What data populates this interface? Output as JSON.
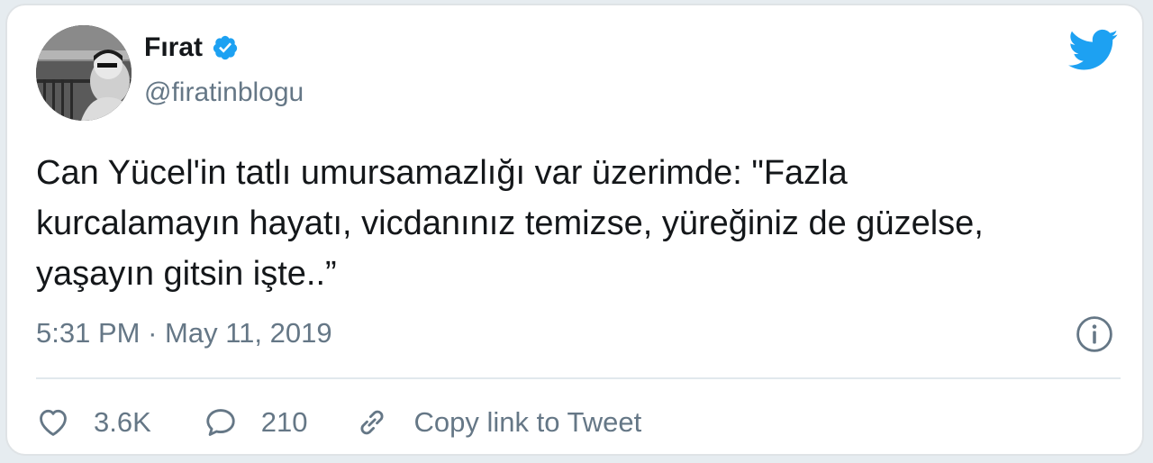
{
  "user": {
    "display_name": "Fırat",
    "handle": "@firatinblogu",
    "avatar_icon": "profile-photo"
  },
  "tweet": {
    "text_lines": [
      "Can Yücel'in tatlı umursamazlığı var üzerimde: \"Fazla",
      "kurcalamayın hayatı, vicdanınız temizse, yüreğiniz de güzelse,",
      "yaşayın gitsin işte..”"
    ],
    "time": "5:31 PM",
    "separator": "·",
    "date": "May 11, 2019"
  },
  "actions": {
    "likes": "3.6K",
    "replies": "210",
    "copy_link_label": "Copy link to Tweet"
  },
  "icons": {
    "brand": "twitter-bird-icon",
    "verified": "verified-badge-icon",
    "info": "info-icon",
    "like": "heart-icon",
    "reply": "speech-bubble-icon",
    "copy": "link-icon"
  },
  "colors": {
    "twitter_blue": "#1da1f2",
    "secondary_text": "#657786",
    "primary_text": "#14171a",
    "divider": "#e1e8ed"
  }
}
